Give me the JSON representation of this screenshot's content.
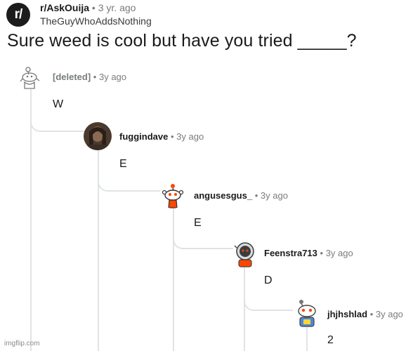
{
  "post": {
    "subreddit": "r/AskOuija",
    "subreddit_icon_text": "r/",
    "separator": "•",
    "post_age": "3 yr. ago",
    "author": "TheGuyWhoAddsNothing",
    "title": "Sure weed is cool but have you tried _____?"
  },
  "comments": [
    {
      "user": "[deleted]",
      "time": "3y ago",
      "text": "W"
    },
    {
      "user": "fuggindave",
      "time": "3y ago",
      "text": "E"
    },
    {
      "user": "angusesgus_",
      "time": "3y ago",
      "text": "E"
    },
    {
      "user": "Feenstra713",
      "time": "3y ago",
      "text": "D"
    },
    {
      "user": "jhjhshlad",
      "time": "3y ago",
      "text": "2"
    }
  ],
  "watermark": "imgflip.com",
  "colors": {
    "thread_line": "#e0e3e6",
    "meta_gray": "#787c7e",
    "snoo_orange": "#ff4500"
  }
}
